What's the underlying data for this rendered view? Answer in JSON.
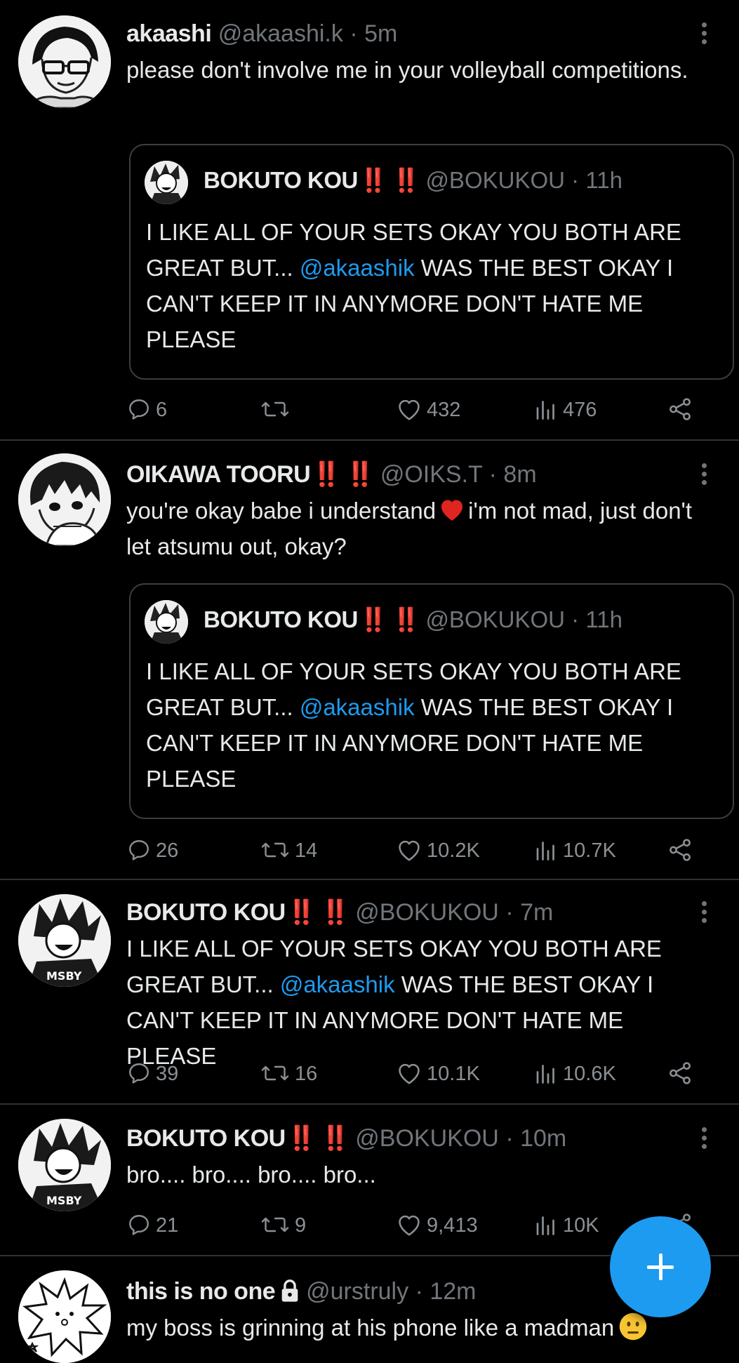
{
  "colors": {
    "background": "#000000",
    "text": "#e7e9ea",
    "muted": "#71767b",
    "accent": "#1d9bf0",
    "bangs": "#e0241f",
    "divider": "#2f3336"
  },
  "tweets": [
    {
      "name": "akaashi",
      "handle": "@akaashi.k",
      "separator": "·",
      "time": "5m",
      "text": "please don't involve me in your volleyball competitions.",
      "quote": {
        "name": "BOKUTO KOU",
        "bangs": "‼️ ‼️",
        "handle": "@BOKUKOU",
        "separator": "·",
        "time": "11h",
        "text_before": "I LIKE ALL OF YOUR SETS OKAY YOU BOTH ARE GREAT BUT... ",
        "mention": "@akaashik",
        "text_after": " WAS THE BEST OKAY I CAN'T KEEP IT IN ANYMORE DON'T HATE ME PLEASE"
      },
      "replies": "6",
      "retweets": "",
      "likes": "432",
      "views": "476"
    },
    {
      "name": "OIKAWA TOORU",
      "bangs": "‼️ ‼️",
      "handle": "@OIKS.T",
      "separator": "·",
      "time": "8m",
      "text_before": "you're okay babe i understand",
      "text_after": "i'm not mad, just don't let atsumu out, okay?",
      "quote": {
        "name": "BOKUTO KOU",
        "bangs": "‼️ ‼️",
        "handle": "@BOKUKOU",
        "separator": "·",
        "time": "11h",
        "text_before": "I LIKE ALL OF YOUR SETS OKAY YOU BOTH ARE GREAT BUT... ",
        "mention": "@akaashik",
        "text_after": " WAS THE BEST OKAY I CAN'T KEEP IT IN ANYMORE DON'T HATE ME PLEASE"
      },
      "replies": "26",
      "retweets": "14",
      "likes": "10.2K",
      "views": "10.7K"
    },
    {
      "name": "BOKUTO KOU",
      "bangs": "‼️ ‼️",
      "handle": "@BOKUKOU",
      "separator": "·",
      "time": "7m",
      "text_before": "I LIKE ALL OF YOUR SETS OKAY YOU BOTH ARE GREAT BUT... ",
      "mention": "@akaashik",
      "text_after": " WAS THE BEST OKAY I CAN'T KEEP IT IN ANYMORE DON'T HATE ME PLEASE",
      "replies": "39",
      "retweets": "16",
      "likes": "10.1K",
      "views": "10.6K"
    },
    {
      "name": "BOKUTO KOU",
      "bangs": "‼️ ‼️",
      "handle": "@BOKUKOU",
      "separator": "·",
      "time": "10m",
      "text": "bro.... bro.... bro.... bro...",
      "replies": "21",
      "retweets": "9",
      "likes": "9,413",
      "views": "10K"
    },
    {
      "name": "this is no one",
      "handle": "@urstruly",
      "separator": "·",
      "time": "12m",
      "text": "my boss is grinning at his phone like a madman"
    }
  ],
  "icons": {
    "reply": "reply-icon",
    "retweet": "retweet-icon",
    "like": "heart-icon",
    "views": "views-icon",
    "share": "share-icon",
    "more": "more-icon",
    "compose": "plus-icon",
    "lock": "lock-icon",
    "heart_emoji": "red-heart-emoji",
    "face_emoji": "neutral-face-emoji"
  }
}
